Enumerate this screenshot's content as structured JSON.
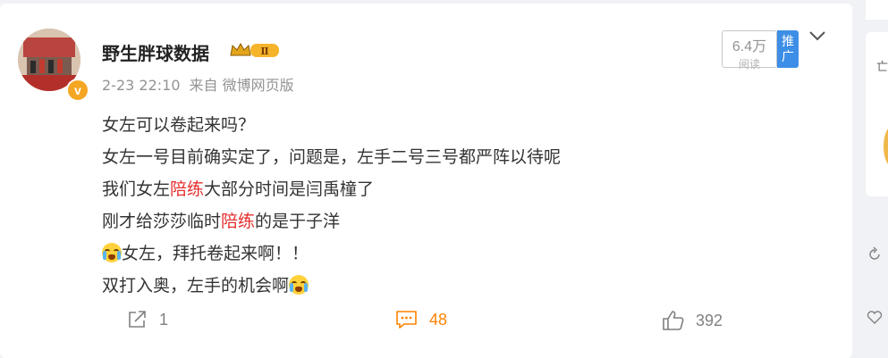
{
  "post": {
    "username": "野生胖球数据",
    "vip_level": "Ⅱ",
    "verified_mark": "v",
    "time": "2-23 22:10",
    "source": "来自 微博网页版",
    "reads": {
      "count": "6.4万",
      "label": "阅读"
    },
    "promo_label": "推广",
    "lines": {
      "l1": "女左可以卷起来吗？",
      "l2": "女左一号目前确实定了，问题是，左手二号三号都严阵以待呢",
      "l3_a": "我们女左",
      "l3_hl": "陪练",
      "l3_b": "大部分时间是闫禹橦了",
      "l4_a": "刚才给莎莎临时",
      "l4_hl": "陪练",
      "l4_b": "的是于子洋",
      "l5": "女左，拜托卷起来啊！！",
      "l6": "双打入奥，左手的机会啊"
    }
  },
  "actions": {
    "share_count": "1",
    "comment_count": "48",
    "like_count": "392"
  },
  "side": {
    "glyph": "亡"
  },
  "colors": {
    "highlight": "#e62e2e",
    "comment_active": "#ff8200",
    "promo_bg": "#3d8ee6"
  },
  "icons": [
    "share-icon",
    "comment-icon",
    "like-icon",
    "chevron-down-icon",
    "vip-crown-icon",
    "crying-emoji-icon"
  ]
}
